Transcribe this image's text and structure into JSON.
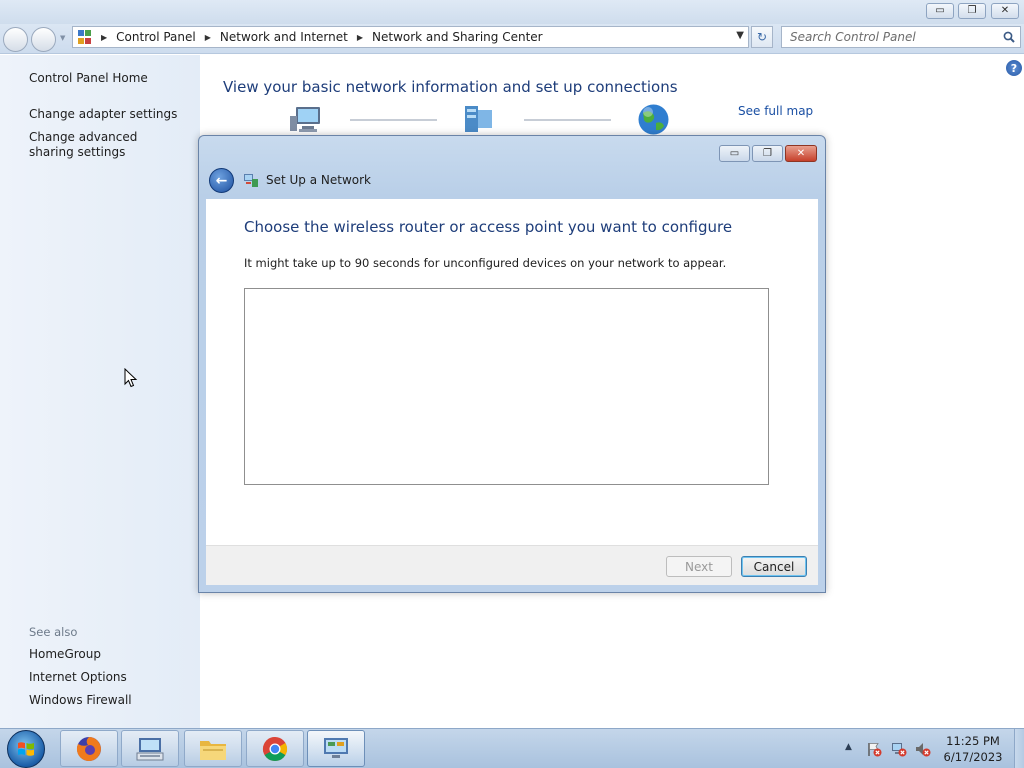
{
  "window": {
    "minimize_glyph": "▭",
    "maximize_glyph": "❐",
    "close_glyph": "✕"
  },
  "address_bar": {
    "breadcrumbs": [
      "Control Panel",
      "Network and Internet",
      "Network and Sharing Center"
    ],
    "refresh_glyph": "↻"
  },
  "search": {
    "placeholder": "Search Control Panel"
  },
  "left_pane": {
    "home": "Control Panel Home",
    "links": [
      "Change adapter settings",
      "Change advanced sharing settings"
    ],
    "see_also_label": "See also",
    "see_also_links": [
      "HomeGroup",
      "Internet Options",
      "Windows Firewall"
    ]
  },
  "main": {
    "title": "View your basic network information and set up connections",
    "see_full_map": "See full map",
    "help_glyph": "?"
  },
  "dialog": {
    "title": "Set Up a Network",
    "heading": "Choose the wireless router or access point you want to configure",
    "subtitle": "It might take up to 90 seconds for unconfigured devices on your network to appear.",
    "next_label": "Next",
    "cancel_label": "Cancel",
    "next_enabled": false,
    "devices": []
  },
  "taskbar": {
    "pinned": [
      "firefox",
      "keyboard",
      "file-explorer",
      "chrome",
      "network-control-panel"
    ],
    "clock_time": "11:25 PM",
    "clock_date": "6/17/2023"
  },
  "colors": {
    "title_blue": "#1e3d7a",
    "link_blue": "#1a4fa3",
    "left_pane_bg": "#e8eff8",
    "close_red": "#c6402b"
  }
}
